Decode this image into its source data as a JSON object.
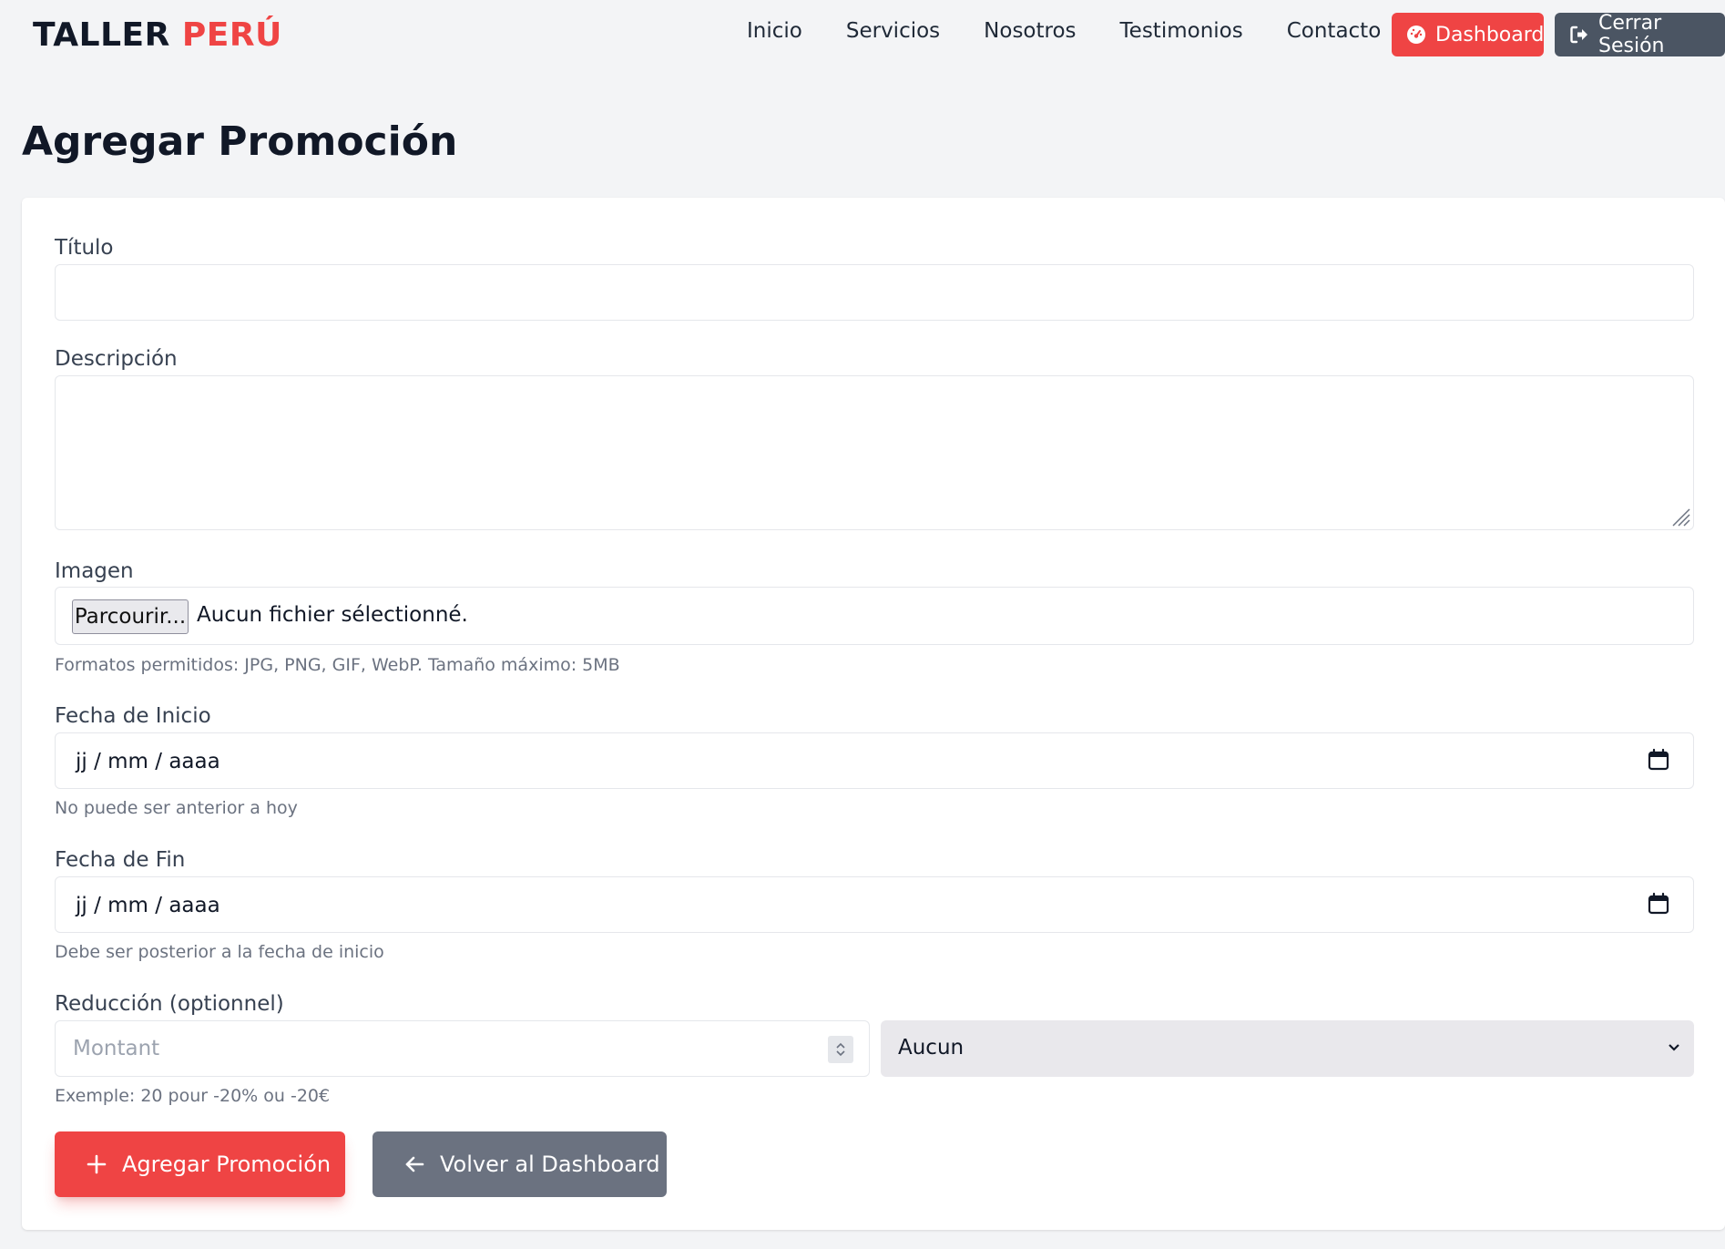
{
  "brand": {
    "part1": "TALLER",
    "part2": "PERÚ"
  },
  "nav": {
    "links": [
      "Inicio",
      "Servicios",
      "Nosotros",
      "Testimonios",
      "Contacto"
    ],
    "dashboard_label": "Dashboard",
    "dashboard_icon": "gauge-icon",
    "logout_label": "Cerrar Sesión",
    "logout_icon": "sign-out-icon"
  },
  "page": {
    "title": "Agregar Promoción"
  },
  "form": {
    "titulo": {
      "label": "Título",
      "value": ""
    },
    "descripcion": {
      "label": "Descripción",
      "value": ""
    },
    "imagen": {
      "label": "Imagen",
      "browse_label": "Parcourir...",
      "no_file_text": "Aucun fichier sélectionné.",
      "hint": "Formatos permitidos: JPG, PNG, GIF, WebP. Tamaño máximo: 5MB"
    },
    "fecha_inicio": {
      "label": "Fecha de Inicio",
      "placeholder": "jj / mm / aaaa",
      "hint": "No puede ser anterior a hoy"
    },
    "fecha_fin": {
      "label": "Fecha de Fin",
      "placeholder": "jj / mm / aaaa",
      "hint": "Debe ser posterior a la fecha de inicio"
    },
    "reduccion": {
      "label": "Reducción (optionnel)",
      "amount_placeholder": "Montant",
      "type_selected": "Aucun",
      "hint": "Exemple: 20 pour -20% ou -20€"
    },
    "submit_label": "Agregar Promoción",
    "submit_icon": "plus-icon",
    "back_label": "Volver al Dashboard",
    "back_icon": "arrow-left-icon"
  },
  "colors": {
    "accent": "#ef4444",
    "dark_button": "#4b5563",
    "secondary_button": "#6b7280",
    "background": "#f3f4f6"
  }
}
